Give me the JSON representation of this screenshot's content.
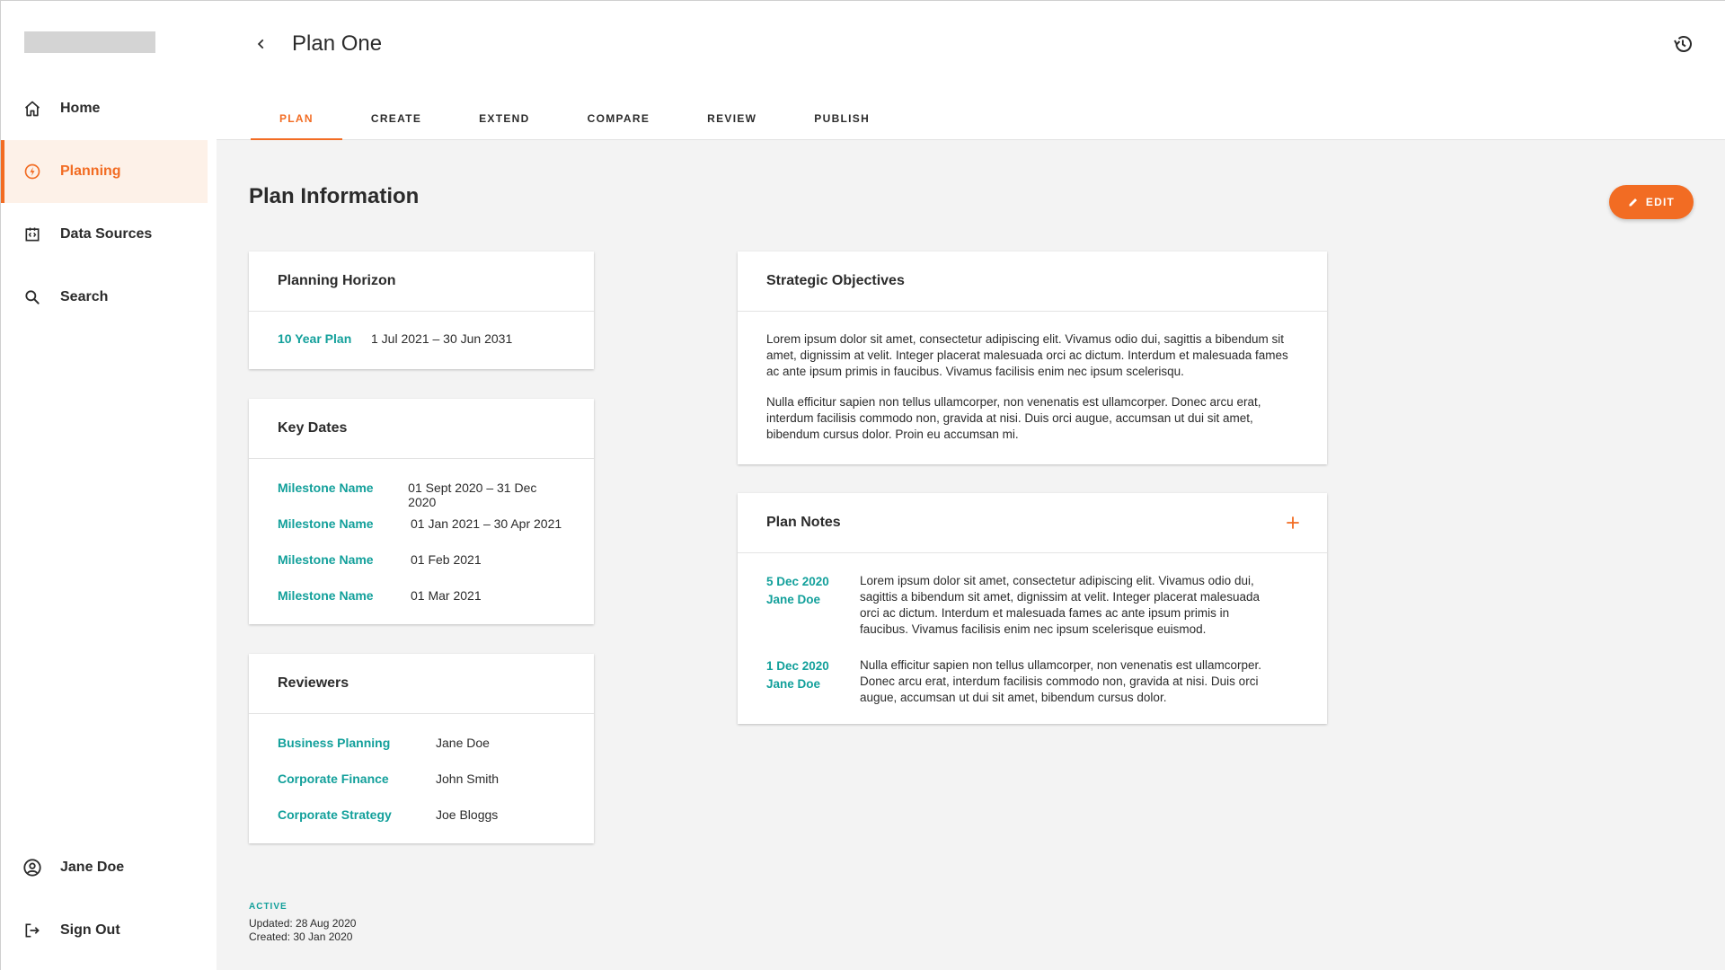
{
  "sidebar": {
    "items": [
      {
        "label": "Home",
        "icon": "home-icon"
      },
      {
        "label": "Planning",
        "icon": "planning-icon"
      },
      {
        "label": "Data Sources",
        "icon": "data-sources-icon"
      },
      {
        "label": "Search",
        "icon": "search-icon"
      }
    ],
    "user": {
      "label": "Jane Doe",
      "icon": "user-icon"
    },
    "signout": {
      "label": "Sign Out",
      "icon": "sign-out-icon"
    }
  },
  "header": {
    "title": "Plan One",
    "tabs": [
      "PLAN",
      "CREATE",
      "EXTEND",
      "COMPARE",
      "REVIEW",
      "PUBLISH"
    ]
  },
  "main": {
    "title": "Plan Information",
    "edit_label": "EDIT",
    "planning_horizon": {
      "title": "Planning Horizon",
      "key": "10 Year Plan",
      "value": "1 Jul 2021 – 30 Jun 2031"
    },
    "key_dates": {
      "title": "Key Dates",
      "rows": [
        {
          "key": "Milestone Name",
          "value": "01 Sept 2020 – 31 Dec 2020"
        },
        {
          "key": "Milestone Name",
          "value": "01 Jan 2021 – 30 Apr 2021"
        },
        {
          "key": "Milestone Name",
          "value": "01 Feb 2021"
        },
        {
          "key": "Milestone Name",
          "value": "01 Mar 2021"
        }
      ]
    },
    "reviewers": {
      "title": "Reviewers",
      "rows": [
        {
          "key": "Business Planning",
          "value": "Jane Doe"
        },
        {
          "key": "Corporate Finance",
          "value": "John Smith"
        },
        {
          "key": "Corporate Strategy",
          "value": "Joe Bloggs"
        }
      ]
    },
    "strategic_objectives": {
      "title": "Strategic Objectives",
      "paragraphs": [
        "Lorem ipsum dolor sit amet, consectetur adipiscing elit. Vivamus odio dui, sagittis a bibendum sit amet, dignissim at velit. Integer placerat malesuada orci ac dictum. Interdum et malesuada fames ac ante ipsum primis in faucibus. Vivamus facilisis enim nec ipsum scelerisqu.",
        "Nulla efficitur sapien non tellus ullamcorper, non venenatis est ullamcorper. Donec arcu erat, interdum facilisis commodo non, gravida at nisi. Duis orci augue, accumsan ut dui sit amet, bibendum cursus dolor. Proin eu accumsan mi."
      ]
    },
    "plan_notes": {
      "title": "Plan Notes",
      "notes": [
        {
          "date": "5 Dec 2020",
          "author": "Jane Doe",
          "text": "Lorem ipsum dolor sit amet, consectetur adipiscing elit. Vivamus odio dui, sagittis a bibendum sit amet, dignissim at velit. Integer placerat malesuada orci ac dictum. Interdum et malesuada fames ac ante ipsum primis in faucibus. Vivamus facilisis enim nec ipsum scelerisque euismod."
        },
        {
          "date": "1 Dec 2020",
          "author": "Jane Doe",
          "text": "Nulla efficitur sapien non tellus ullamcorper, non venenatis est ullamcorper. Donec arcu erat, interdum facilisis commodo non, gravida at nisi. Duis orci augue, accumsan ut dui sit amet, bibendum cursus dolor."
        }
      ]
    },
    "status": {
      "badge": "ACTIVE",
      "updated": "Updated: 28 Aug 2020",
      "created": "Created: 30 Jan 2020"
    }
  },
  "colors": {
    "accent": "#f26c23",
    "teal": "#13a09b",
    "background": "#f3f3f3"
  }
}
